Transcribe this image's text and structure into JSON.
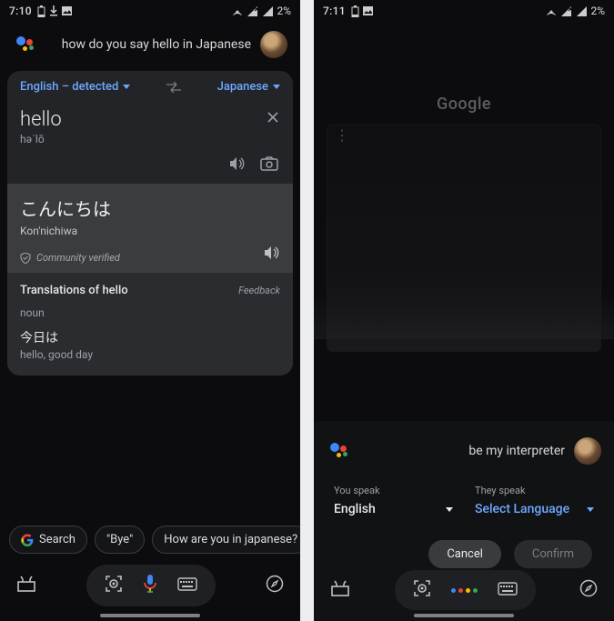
{
  "left": {
    "status": {
      "time": "7:10",
      "battery": "2%"
    },
    "assistant_query": "how do you say hello in Japanese",
    "translate": {
      "src_lang": "English – detected",
      "tgt_lang": "Japanese",
      "src_word": "hello",
      "src_phon": "həˈlō",
      "tgt_word": "こんにちは",
      "tgt_roman": "Kon'nichiwa",
      "verified": "Community verified",
      "defs_title": "Translations of hello",
      "feedback": "Feedback",
      "pos": "noun",
      "def_jp": "今日は",
      "def_gloss": "hello, good day"
    },
    "chips": {
      "search": "Search",
      "bye": "\"Bye\"",
      "howare": "How are you in japanese?"
    }
  },
  "right": {
    "status": {
      "time": "7:11",
      "battery": "2%"
    },
    "bg_label": "Google",
    "assistant_query": "be my interpreter",
    "interpreter": {
      "you_label": "You speak",
      "you_value": "English",
      "they_label": "They speak",
      "they_value": "Select Language",
      "cancel": "Cancel",
      "confirm": "Confirm"
    }
  }
}
